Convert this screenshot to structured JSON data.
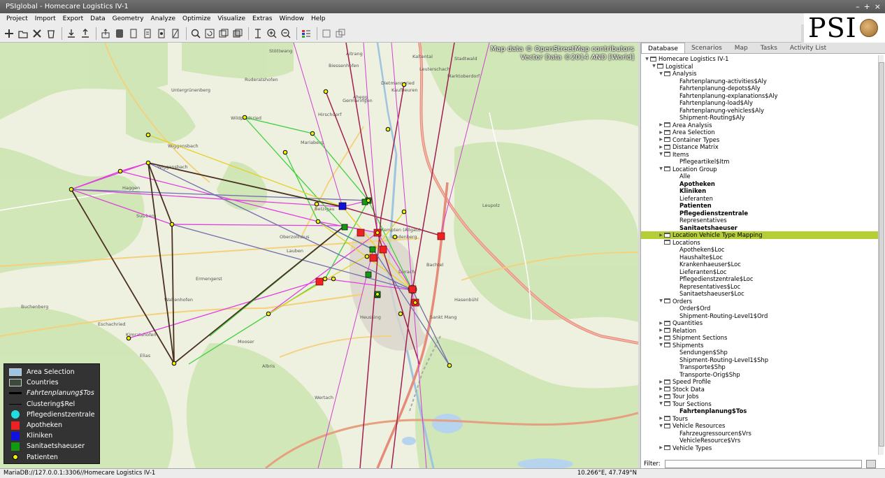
{
  "window": {
    "title": "PSIglobal - Homecare Logistics IV-1"
  },
  "menu": [
    "Project",
    "Import",
    "Export",
    "Data",
    "Geometry",
    "Analyze",
    "Optimize",
    "Visualize",
    "Extras",
    "Window",
    "Help"
  ],
  "logo": {
    "text": "PSI"
  },
  "map": {
    "attribution_1": "Map data © OpenStreetMap contributors",
    "attribution_2": "Vector Data ©2014 AND [World]",
    "legend": [
      {
        "label": "Area Selection",
        "symbol": "area",
        "color": "#9cc4e4"
      },
      {
        "label": "Countries",
        "symbol": "area",
        "color": "#3c4a3c"
      },
      {
        "label": "Fahrtenplanung$Tos",
        "symbol": "thick-line",
        "color": "#000000"
      },
      {
        "label": "Clustering$Rel",
        "symbol": "thin-line",
        "color": "#000000"
      },
      {
        "label": "Pflegedienstzentrale",
        "symbol": "circle",
        "color": "#22dddd"
      },
      {
        "label": "Apotheken",
        "symbol": "square",
        "color": "#ee2222"
      },
      {
        "label": "Kliniken",
        "symbol": "square",
        "color": "#1111dd"
      },
      {
        "label": "Sanitaetshaeuser",
        "symbol": "square",
        "color": "#119911"
      },
      {
        "label": "Patienten",
        "symbol": "dot",
        "color": "#f0f000"
      }
    ],
    "places": [
      {
        "name": "Stöttwang"
      },
      {
        "name": "Aitrang"
      },
      {
        "name": "Kaltental"
      },
      {
        "name": "Stadtwald"
      },
      {
        "name": "Biessenhofen"
      },
      {
        "name": "Leuterschach"
      },
      {
        "name": "Marktoberdorf"
      },
      {
        "name": "Ruderatshofen"
      },
      {
        "name": "Kaufbeuren"
      },
      {
        "name": "Germaringen"
      },
      {
        "name": "Wiggensbach"
      },
      {
        "name": "Kempten (Allgäu)"
      },
      {
        "name": "Haggen"
      },
      {
        "name": "Sulzberg"
      },
      {
        "name": "Durach"
      },
      {
        "name": "Betzigau"
      },
      {
        "name": "Wildpoldsried"
      },
      {
        "name": "Lauben"
      },
      {
        "name": "Buchenberg"
      },
      {
        "name": "Waltenhofen"
      },
      {
        "name": "Oberzollhaus"
      },
      {
        "name": "Wiggensbach"
      },
      {
        "name": "Untergrünenberg"
      },
      {
        "name": "Dietmannsried"
      },
      {
        "name": "Sankt Mang"
      },
      {
        "name": "Heussing"
      },
      {
        "name": "Albris"
      },
      {
        "name": "Kimratshofen"
      },
      {
        "name": "Wertach"
      },
      {
        "name": "Lindenberg"
      },
      {
        "name": "Hasenbühl"
      },
      {
        "name": "Mariaberg"
      },
      {
        "name": "Ermengerst"
      },
      {
        "name": "Eschachried"
      },
      {
        "name": "Mooser"
      },
      {
        "name": "Bachtel"
      },
      {
        "name": "Hirschdorf"
      },
      {
        "name": "Leupolz"
      },
      {
        "name": "Elias"
      },
      {
        "name": "Ahegg"
      }
    ]
  },
  "panel": {
    "tabs": [
      "Database",
      "Scenarios",
      "Map",
      "Tasks",
      "Activity List"
    ],
    "active_tab": "Database",
    "tree": [
      {
        "label": "Homecare Logistics IV-1",
        "level": 0,
        "expander": "▼",
        "folder": true
      },
      {
        "label": "Logistical",
        "level": 1,
        "expander": "▼",
        "folder": true
      },
      {
        "label": "Analysis",
        "level": 2,
        "expander": "▼",
        "folder": true
      },
      {
        "label": "Fahrtenplanung-activities$Aly",
        "level": 3
      },
      {
        "label": "Fahrtenplanung-depots$Aly",
        "level": 3
      },
      {
        "label": "Fahrtenplanung-explanations$Aly",
        "level": 3
      },
      {
        "label": "Fahrtenplanung-load$Aly",
        "level": 3
      },
      {
        "label": "Fahrtenplanung-vehicles$Aly",
        "level": 3
      },
      {
        "label": "Shipment-Routing$Aly",
        "level": 3
      },
      {
        "label": "Area Analysis",
        "level": 2,
        "expander": "▶",
        "folder": true
      },
      {
        "label": "Area Selection",
        "level": 2,
        "expander": "▶",
        "folder": true
      },
      {
        "label": "Container Types",
        "level": 2,
        "expander": "▶",
        "folder": true
      },
      {
        "label": "Distance Matrix",
        "level": 2,
        "expander": "▶",
        "folder": true
      },
      {
        "label": "Items",
        "level": 2,
        "expander": "▼",
        "folder": true
      },
      {
        "label": "Pflegeartikel$Itm",
        "level": 3
      },
      {
        "label": "Location Group",
        "level": 2,
        "expander": "▼",
        "folder": true
      },
      {
        "label": "Alle",
        "level": 3
      },
      {
        "label": "Apotheken",
        "level": 3,
        "bold": true
      },
      {
        "label": "Kliniken",
        "level": 3,
        "bold": true
      },
      {
        "label": "Lieferanten",
        "level": 3
      },
      {
        "label": "Patienten",
        "level": 3,
        "bold": true
      },
      {
        "label": "Pflegedienstzentrale",
        "level": 3,
        "bold": true
      },
      {
        "label": "Representatives",
        "level": 3
      },
      {
        "label": "Sanitaetshaeuser",
        "level": 3,
        "bold": true
      },
      {
        "label": "Location Vehicle Type Mapping",
        "level": 2,
        "expander": "▶",
        "folder": true,
        "selected": true
      },
      {
        "label": "Locations",
        "level": 2,
        "expander": "",
        "folder": true
      },
      {
        "label": "Apotheken$Loc",
        "level": 3
      },
      {
        "label": "Haushalte$Loc",
        "level": 3
      },
      {
        "label": "Krankenhaeuser$Loc",
        "level": 3
      },
      {
        "label": "Lieferanten$Loc",
        "level": 3
      },
      {
        "label": "Pflegedienstzentrale$Loc",
        "level": 3
      },
      {
        "label": "Representatives$Loc",
        "level": 3
      },
      {
        "label": "Sanitaetshaeuser$Loc",
        "level": 3
      },
      {
        "label": "Orders",
        "level": 2,
        "expander": "▼",
        "folder": true
      },
      {
        "label": "Order$Ord",
        "level": 3
      },
      {
        "label": "Shipment-Routing-Level1$Ord",
        "level": 3
      },
      {
        "label": "Quantities",
        "level": 2,
        "expander": "▶",
        "folder": true
      },
      {
        "label": "Relation",
        "level": 2,
        "expander": "▶",
        "folder": true
      },
      {
        "label": "Shipment Sections",
        "level": 2,
        "expander": "▶",
        "folder": true
      },
      {
        "label": "Shipments",
        "level": 2,
        "expander": "▼",
        "folder": true
      },
      {
        "label": "Sendungen$Shp",
        "level": 3
      },
      {
        "label": "Shipment-Routing-Level1$Shp",
        "level": 3
      },
      {
        "label": "Transporte$Shp",
        "level": 3
      },
      {
        "label": "Transporte-Orig$Shp",
        "level": 3
      },
      {
        "label": "Speed Profile",
        "level": 2,
        "expander": "▶",
        "folder": true
      },
      {
        "label": "Stock Data",
        "level": 2,
        "expander": "▶",
        "folder": true
      },
      {
        "label": "Tour Jobs",
        "level": 2,
        "expander": "▶",
        "folder": true
      },
      {
        "label": "Tour Sections",
        "level": 2,
        "expander": "▼",
        "folder": true
      },
      {
        "label": "Fahrtenplanung$Tos",
        "level": 3,
        "bold": true
      },
      {
        "label": "Tours",
        "level": 2,
        "expander": "▶",
        "folder": true
      },
      {
        "label": "Vehicle Resources",
        "level": 2,
        "expander": "▼",
        "folder": true
      },
      {
        "label": "Fahrzeugressourcen$Vrs",
        "level": 3
      },
      {
        "label": "VehicleResource$Vrs",
        "level": 3
      },
      {
        "label": "Vehicle Types",
        "level": 2,
        "expander": "▶",
        "folder": true
      }
    ],
    "filter_label": "Filter:",
    "filter_value": ""
  },
  "status": {
    "connection": "MariaDB://127.0.0.1:3306//Homecare Logistics IV-1",
    "coordinates": "10.266°E, 47.749°N"
  }
}
